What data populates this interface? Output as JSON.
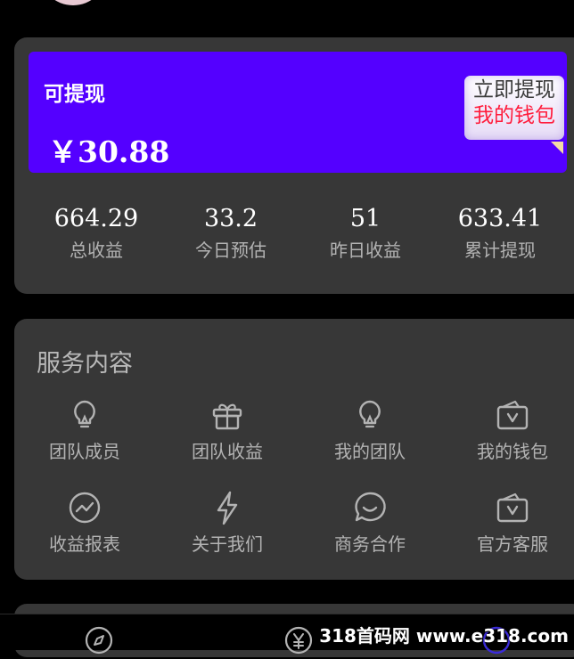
{
  "balance": {
    "label": "可提现",
    "amount": "￥30.88",
    "wallet_button": {
      "line1": "立即提现",
      "line2": "我的钱包"
    }
  },
  "stats": [
    {
      "value": "664.29",
      "label": "总收益"
    },
    {
      "value": "33.2",
      "label": "今日预估"
    },
    {
      "value": "51",
      "label": "昨日收益"
    },
    {
      "value": "633.41",
      "label": "累计提现"
    }
  ],
  "services": {
    "title": "服务内容",
    "items": [
      {
        "label": "团队成员",
        "icon": "lightbulb-icon"
      },
      {
        "label": "团队收益",
        "icon": "gift-icon"
      },
      {
        "label": "我的团队",
        "icon": "lightbulb-icon"
      },
      {
        "label": "我的钱包",
        "icon": "wallet-icon"
      },
      {
        "label": "收益报表",
        "icon": "chart-circle-icon"
      },
      {
        "label": "关于我们",
        "icon": "lightning-icon"
      },
      {
        "label": "商务合作",
        "icon": "chat-bubble-icon"
      },
      {
        "label": "官方客服",
        "icon": "wallet-icon"
      }
    ]
  },
  "tabbar": {
    "icons": [
      "compass-icon",
      "yen-icon",
      "circle-icon"
    ]
  },
  "watermark": "318首码网 www.e318.com",
  "colors": {
    "background": "#000000",
    "card": "#373737",
    "balance_bg": "#5400ff",
    "wallet_text_red": "#ff1c3c",
    "muted_text": "#b3b3b3"
  }
}
